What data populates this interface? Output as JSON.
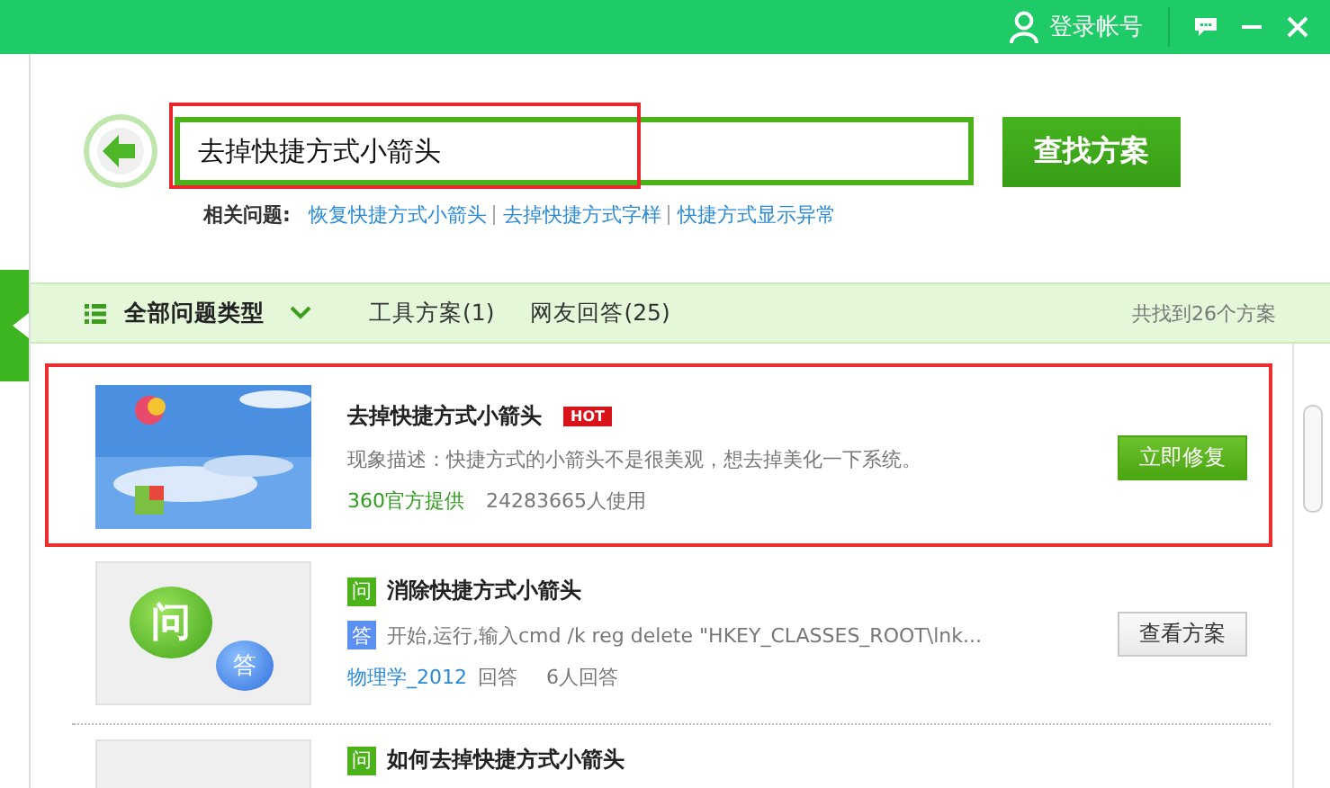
{
  "title_bar": {
    "account": "登录帐号"
  },
  "search": {
    "value": "去掉快捷方式小箭头",
    "highlighted": true,
    "button": "查找方案"
  },
  "related": {
    "label": "相关问题:",
    "links": [
      "恢复快捷方式小箭头",
      "去掉快捷方式字样",
      "快捷方式显示异常"
    ]
  },
  "filter": {
    "category": "全部问题类型",
    "tabs": [
      {
        "label": "工具方案(1)"
      },
      {
        "label": "网友回答(25)"
      }
    ],
    "count": "共找到26个方案"
  },
  "results": [
    {
      "kind": "tool",
      "highlighted": true,
      "title": "去掉快捷方式小箭头",
      "badge": "HOT",
      "description": "现象描述：快捷方式的小箭头不是很美观，想去掉美化一下系统。",
      "provider": "360官方提供",
      "users": "24283665人使用",
      "button": "立即修复"
    },
    {
      "kind": "answer",
      "highlighted": false,
      "thumb_q": "问",
      "thumb_a": "答",
      "q_mark": "问",
      "title": "消除快捷方式小箭头",
      "a_mark": "答",
      "description": "开始,运行,输入cmd /k reg delete \"HKEY_CLASSES_ROOT\\lnk...",
      "author": "物理学_2012",
      "answered": "回答",
      "answer_count": "6人回答",
      "button": "查看方案"
    },
    {
      "kind": "answer",
      "highlighted": false,
      "q_mark": "问",
      "title": "如何去掉快捷方式小箭头"
    }
  ]
}
